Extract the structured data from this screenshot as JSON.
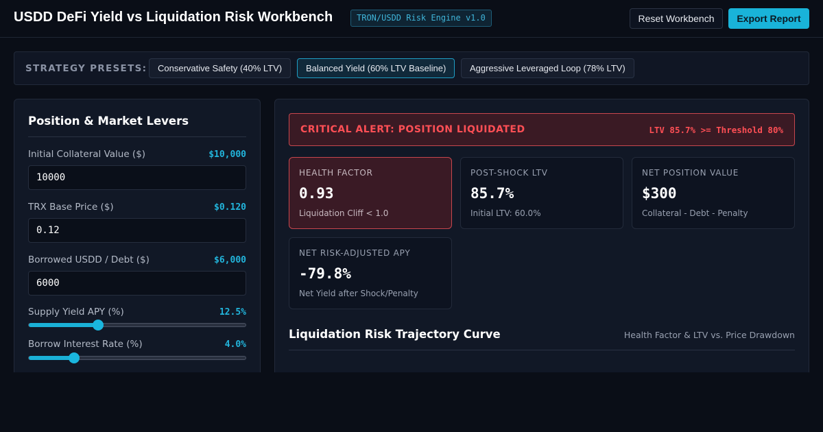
{
  "header": {
    "title": "USDD DeFi Yield vs Liquidation Risk Workbench",
    "badge": "TRON/USDD Risk Engine v1.0",
    "reset_label": "Reset Workbench",
    "export_label": "Export Report"
  },
  "presets": {
    "label": "STRATEGY PRESETS:",
    "items": [
      {
        "label": "Conservative Safety (40% LTV)",
        "active": false
      },
      {
        "label": "Balanced Yield (60% LTV Baseline)",
        "active": true
      },
      {
        "label": "Aggressive Leveraged Loop (78% LTV)",
        "active": false
      }
    ]
  },
  "levers": {
    "title": "Position & Market Levers",
    "collateral": {
      "label": "Initial Collateral Value ($)",
      "display": "$10,000",
      "input": "10000"
    },
    "trx_price": {
      "label": "TRX Base Price ($)",
      "display": "$0.120",
      "input": "0.12"
    },
    "debt": {
      "label": "Borrowed USDD / Debt ($)",
      "display": "$6,000",
      "input": "6000"
    },
    "supply_apy": {
      "label": "Supply Yield APY (%)",
      "display": "12.5%",
      "fraction": 0.32
    },
    "borrow_rate": {
      "label": "Borrow Interest Rate (%)",
      "display": "4.0%",
      "fraction": 0.21
    }
  },
  "alert": {
    "title": "CRITICAL ALERT: POSITION LIQUIDATED",
    "detail": "LTV 85.7% >= Threshold 80%",
    "color": "#ff4f55"
  },
  "metrics": {
    "health_factor": {
      "label": "HEALTH FACTOR",
      "value": "0.93",
      "sub": "Liquidation Cliff < 1.0"
    },
    "post_shock_ltv": {
      "label": "POST-SHOCK LTV",
      "value": "85.7%",
      "sub": "Initial LTV: 60.0%"
    },
    "net_position": {
      "label": "NET POSITION VALUE",
      "value": "$300",
      "sub": "Collateral - Debt - Penalty"
    },
    "risk_apy": {
      "label": "NET RISK-ADJUSTED APY",
      "value": "-79.8%",
      "sub": "Net Yield after Shock/Penalty"
    }
  },
  "chart": {
    "title": "Liquidation Risk Trajectory Curve",
    "subtitle": "Health Factor & LTV vs. Price Drawdown"
  },
  "colors": {
    "accent": "#19b3d9",
    "danger": "#ff4f55",
    "background": "#0a0e17"
  }
}
